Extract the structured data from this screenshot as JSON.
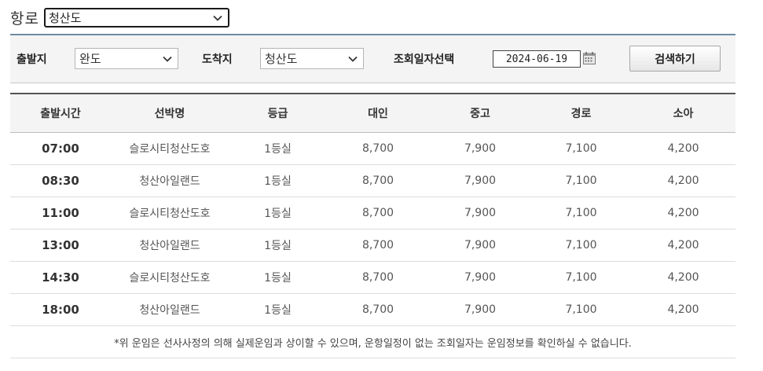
{
  "route": {
    "label": "항로",
    "selected": "청산도"
  },
  "filters": {
    "departure_label": "출발지",
    "departure_value": "완도",
    "arrival_label": "도착지",
    "arrival_value": "청산도",
    "date_label": "조회일자선택",
    "date_value": "2024-06-19",
    "search_label": "검색하기"
  },
  "table": {
    "headers": [
      "출발시간",
      "선박명",
      "등급",
      "대인",
      "중고",
      "경로",
      "소아"
    ],
    "rows": [
      [
        "07:00",
        "슬로시티청산도호",
        "1등실",
        "8,700",
        "7,900",
        "7,100",
        "4,200"
      ],
      [
        "08:30",
        "청산아일랜드",
        "1등실",
        "8,700",
        "7,900",
        "7,100",
        "4,200"
      ],
      [
        "11:00",
        "슬로시티청산도호",
        "1등실",
        "8,700",
        "7,900",
        "7,100",
        "4,200"
      ],
      [
        "13:00",
        "청산아일랜드",
        "1등실",
        "8,700",
        "7,900",
        "7,100",
        "4,200"
      ],
      [
        "14:30",
        "슬로시티청산도호",
        "1등실",
        "8,700",
        "7,900",
        "7,100",
        "4,200"
      ],
      [
        "18:00",
        "청산아일랜드",
        "1등실",
        "8,700",
        "7,900",
        "7,100",
        "4,200"
      ]
    ],
    "note": "*위 운임은 선사사정의 의해 실제운임과 상이할 수 있으며, 운항일정이 없는 조회일자는 운임정보를 확인하실 수 없습니다."
  },
  "icons": {
    "dropdown": "chevron-down-icon",
    "calendar": "calendar-icon"
  },
  "colors": {
    "top_rule": "#6d8ba0",
    "header_bg": "#f4f4f4",
    "table_top_border": "#555555"
  }
}
